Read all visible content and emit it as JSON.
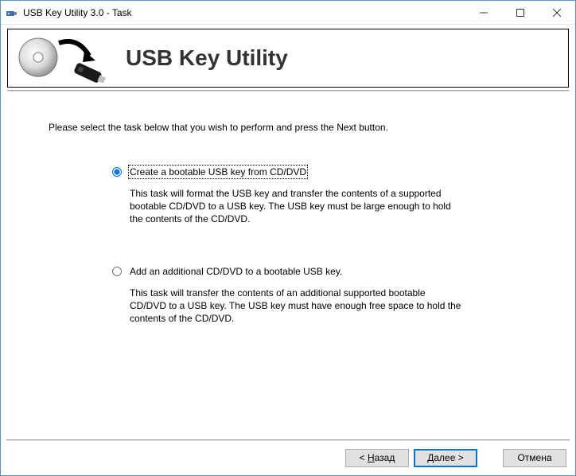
{
  "window": {
    "title": "USB Key Utility 3.0 - Task"
  },
  "header": {
    "title": "USB Key Utility"
  },
  "content": {
    "instruction": "Please select the task below that you wish to perform and press the Next button."
  },
  "options": {
    "opt1": {
      "label": "Create a bootable USB key from CD/DVD",
      "desc": "This task will format the USB key and transfer the contents of a supported bootable CD/DVD to a USB key.  The USB key must be large enough to hold the contents of the CD/DVD.",
      "selected": true
    },
    "opt2": {
      "label": "Add an additional CD/DVD to a bootable USB key.",
      "desc": "This task will transfer the contents of an additional supported bootable CD/DVD to a USB key.  The USB key must have enough free space to hold the contents of the CD/DVD.",
      "selected": false
    }
  },
  "footer": {
    "back_prefix": "< ",
    "back_u": "Н",
    "back_rest": "азад",
    "next_u": "Д",
    "next_rest": "алее >",
    "cancel": "Отмена"
  }
}
